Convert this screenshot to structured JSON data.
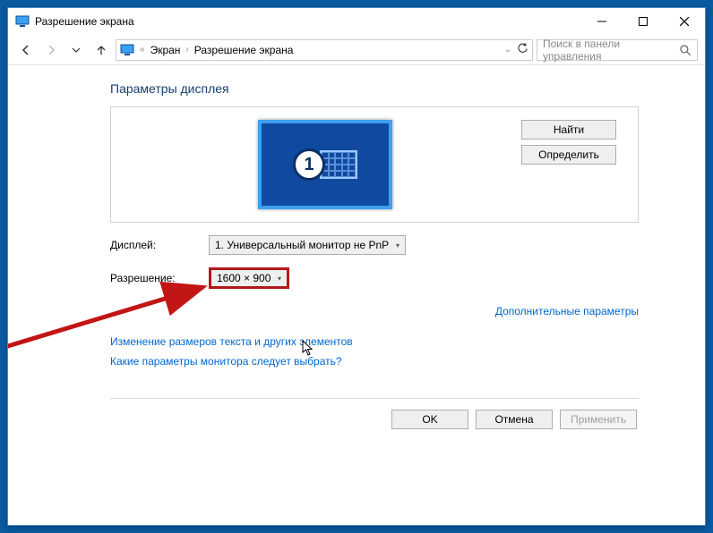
{
  "window": {
    "title": "Разрешение экрана"
  },
  "nav": {
    "breadcrumb": {
      "root_icon": "monitor",
      "seg1": "Экран",
      "seg2": "Разрешение экрана"
    },
    "search_placeholder": "Поиск в панели управления"
  },
  "page": {
    "heading": "Параметры дисплея",
    "monitor_number": "1",
    "find_btn": "Найти",
    "identify_btn": "Определить",
    "display_label": "Дисплей:",
    "display_value": "1. Универсальный монитор не PnP",
    "resolution_label": "Разрешение:",
    "resolution_value": "1600 × 900",
    "advanced_link": "Дополнительные параметры",
    "text_size_link": "Изменение размеров текста и других элементов",
    "which_params_link": "Какие параметры монитора следует выбрать?",
    "ok_btn": "OK",
    "cancel_btn": "Отмена",
    "apply_btn": "Применить"
  },
  "annotation": {
    "arrow_color": "#c21515"
  }
}
